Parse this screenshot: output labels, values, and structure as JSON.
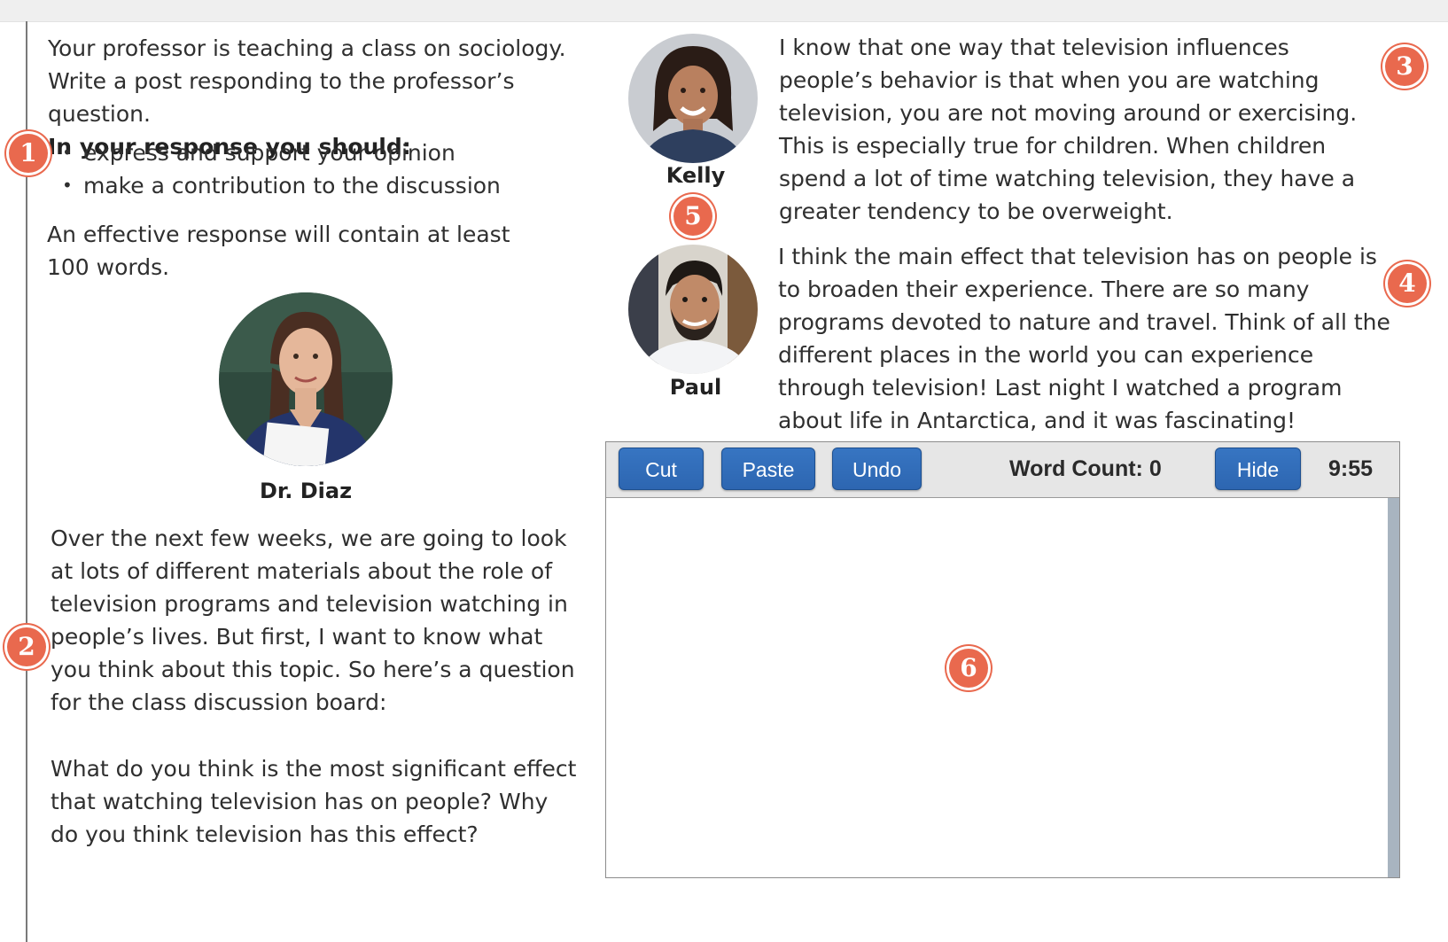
{
  "instructions": {
    "intro": "Your professor is teaching a class on sociology. Write a post responding to the professor’s question.",
    "heading": "In your response you should:",
    "bullets": [
      "express and support your opinion",
      "make a contribution to the discussion"
    ],
    "length_note": "An effective response will contain at least 100 words."
  },
  "professor": {
    "name": "Dr. Diaz",
    "post": "Over the next few weeks, we are going to look at lots of different materials about the role of television programs and television watching in people’s lives. But first, I want to know what you think about this topic. So here’s a question for the class discussion board:",
    "question": "What do you think is the most significant effect that watching television has on people? Why do you think television has this effect?"
  },
  "students": [
    {
      "name": "Kelly",
      "post": "I know that one way that television influences people’s behavior is that when you are watching television, you are not moving around or exercising. This is especially true for children. When children spend a lot of time watching television, they have a greater tendency to be overweight."
    },
    {
      "name": "Paul",
      "post": "I think the main effect that television has on people is to broaden their experience. There are so many programs devoted to nature and travel. Think of all the different places in the world you can experience through television! Last night I watched a program about life in Antarctica, and it was fascinating!"
    }
  ],
  "editor": {
    "cut_label": "Cut",
    "paste_label": "Paste",
    "undo_label": "Undo",
    "word_count_label": "Word Count: 0",
    "hide_label": "Hide",
    "timer": "9:55",
    "response_value": ""
  },
  "markers": [
    "1",
    "2",
    "3",
    "4",
    "5",
    "6"
  ],
  "colors": {
    "marker": "#e9694e",
    "button": "#2d66b1",
    "toolbar": "#e6e6e6",
    "scrollbar": "#a8b4c0"
  }
}
